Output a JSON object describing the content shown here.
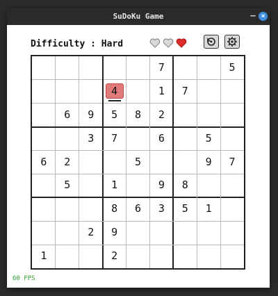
{
  "window": {
    "title": "SuDoKu Game",
    "minimize_label": "–",
    "close_label": "×"
  },
  "header": {
    "difficulty_text": "Difficulty : Hard",
    "hearts": [
      {
        "state": "empty",
        "color": "#9a9a9a"
      },
      {
        "state": "empty",
        "color": "#9a9a9a"
      },
      {
        "state": "full",
        "color": "#e02b2b"
      }
    ],
    "buttons": [
      {
        "name": "undo-button",
        "icon": "undo-icon"
      },
      {
        "name": "settings-button",
        "icon": "gear-icon"
      }
    ]
  },
  "board": {
    "selected": {
      "row": 1,
      "col": 3,
      "value": "4"
    },
    "rows": [
      [
        "",
        "",
        "",
        "",
        "",
        "7",
        "",
        "",
        "5"
      ],
      [
        "",
        "",
        "",
        "4",
        "",
        "1",
        "7",
        "",
        ""
      ],
      [
        "",
        "6",
        "9",
        "5",
        "8",
        "2",
        "",
        "",
        ""
      ],
      [
        "",
        "",
        "3",
        "7",
        "",
        "6",
        "",
        "5",
        ""
      ],
      [
        "6",
        "2",
        "",
        "",
        "5",
        "",
        "",
        "9",
        "7"
      ],
      [
        "",
        "5",
        "",
        "1",
        "",
        "9",
        "8",
        "",
        ""
      ],
      [
        "",
        "",
        "",
        "8",
        "6",
        "3",
        "5",
        "1",
        ""
      ],
      [
        "",
        "",
        "2",
        "9",
        "",
        "",
        "",
        "",
        ""
      ],
      [
        "1",
        "",
        "",
        "2",
        "",
        "",
        "",
        "",
        ""
      ]
    ]
  },
  "footer": {
    "fps_text": "60 FPS",
    "fps_color": "#2e9a2e"
  }
}
